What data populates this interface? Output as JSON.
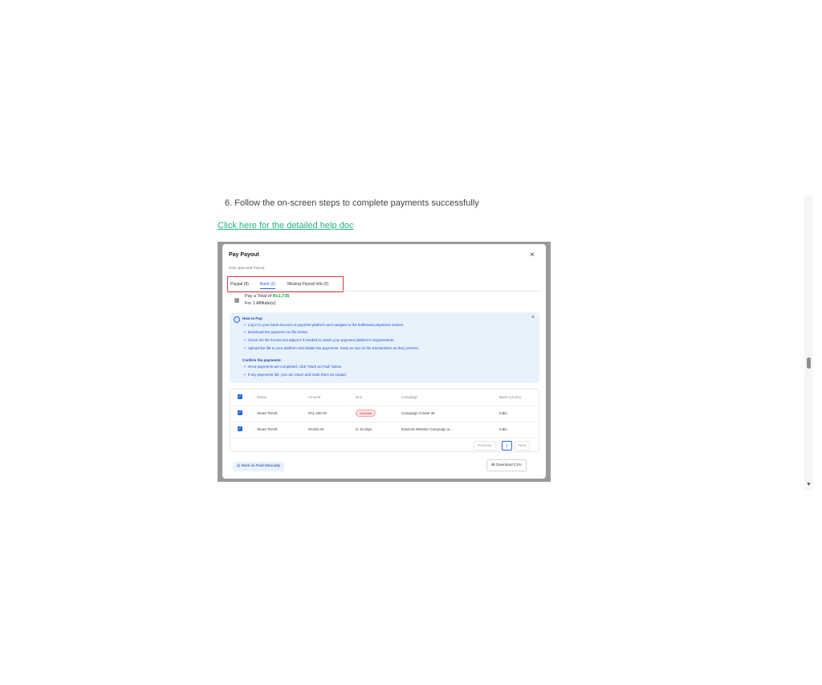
{
  "article": {
    "step_text": "6. Follow the on-screen steps to complete payments successfully",
    "help_link": "Click here for the detailed help doc"
  },
  "dialog": {
    "title": "Pay Payout",
    "subtitle": "Only approved Payout",
    "close_icon": "×",
    "tabs": [
      {
        "label": "Paypal (8)"
      },
      {
        "label": "Bank (2)"
      },
      {
        "label": "Missing Payout Info (2)"
      }
    ],
    "pay_total_prefix": "Pay a Total of ",
    "pay_total_amount": "Rs1,735",
    "affiliates": "For 1 Affiliate(s)",
    "info": {
      "icon": "i",
      "close": "×",
      "how_title": "How to Pay:",
      "how_items": [
        "Log in to your bank account or payment platform and navigate to the bulk/mass payments section.",
        "Download the payment csv file below.",
        "Check the file format and adjust it if needed to match your payment platform's requirements.",
        "Upload the file to your platform and initiate the payments. Keep an eye on the transactions as they process."
      ],
      "confirm_title": "Confirm the payments:",
      "confirm_items": [
        "Once payments are completed, click \"Mark as Paid\" below.",
        "If any payments fail, you can return and mark them as unpaid."
      ]
    },
    "table": {
      "headers": [
        "Name",
        "Amount",
        "Due",
        "Campaign",
        "Bank Country"
      ],
      "rows": [
        {
          "name": "Stuart Terrell",
          "amount": "Rs1,400.00",
          "due": "Overdue",
          "campaign": "Campaign Create 38",
          "country": "India"
        },
        {
          "name": "Stuart Terrell",
          "amount": "Rs335.25",
          "due": "in 19 days",
          "campaign": "External Website Campaign w...",
          "country": "India"
        }
      ],
      "pager": {
        "previous": "Previous",
        "current": "1",
        "next": "Next"
      }
    },
    "mark_paid_button": "Mark as Paid Manually",
    "download_button": "Download CSV"
  },
  "icons": {
    "check": "✓",
    "bank": "▦",
    "mark_icon": "◎",
    "download_icon": "⊕",
    "scroll_down": "▼"
  }
}
